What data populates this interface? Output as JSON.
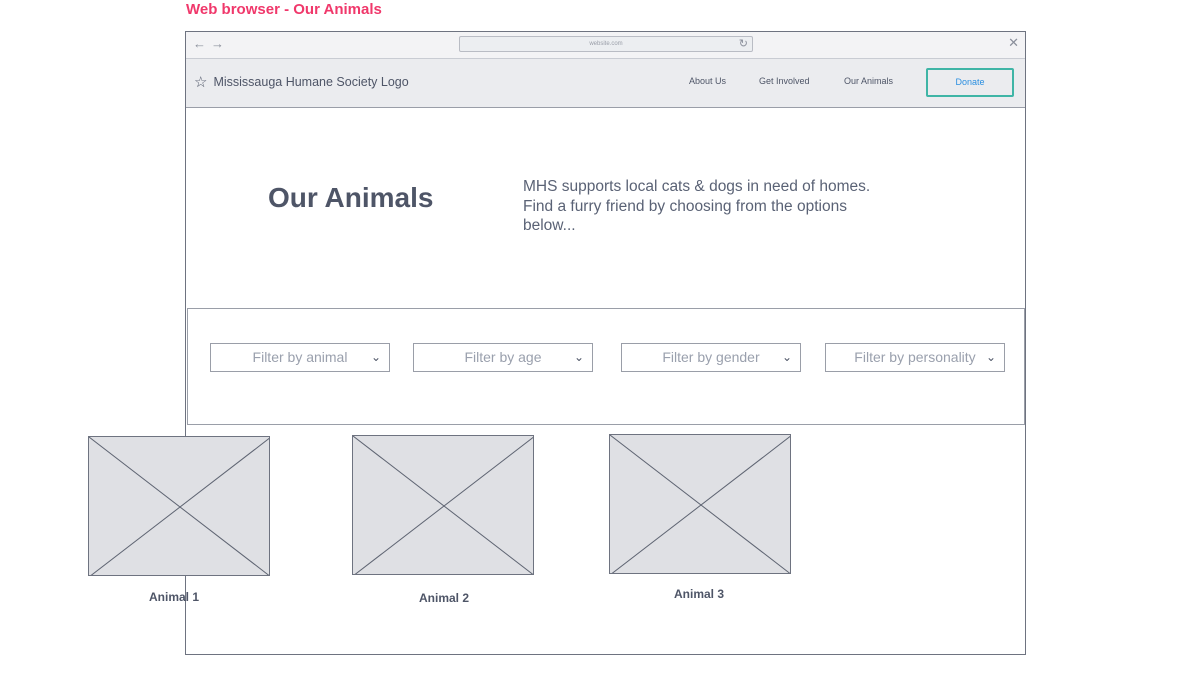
{
  "frame_label": "Web browser - Our Animals",
  "browser": {
    "url": "website.com",
    "back_icon": "←",
    "forward_icon": "→",
    "reload_icon": "↻",
    "close_icon": "✕"
  },
  "header": {
    "logo_icon": "☆",
    "logo_text": "Mississauga Humane Society Logo",
    "nav": [
      "About Us",
      "Get Involved",
      "Our Animals"
    ],
    "donate_label": "Donate"
  },
  "hero": {
    "title": "Our Animals",
    "description": "MHS supports local cats & dogs in need of homes. Find a furry friend by choosing from the options below..."
  },
  "filters": [
    "Filter by animal",
    "Filter by age",
    "Filter by gender",
    "Filter by personality"
  ],
  "chevron_icon": "⌄",
  "animals": [
    "Animal 1",
    "Animal 2",
    "Animal 3"
  ],
  "colors": {
    "frame_label": "#f0386b",
    "donate_border": "#3fb5a6",
    "donate_text": "#2b8fe0",
    "text": "#4e5567",
    "placeholder_fill": "#dfe0e4"
  }
}
